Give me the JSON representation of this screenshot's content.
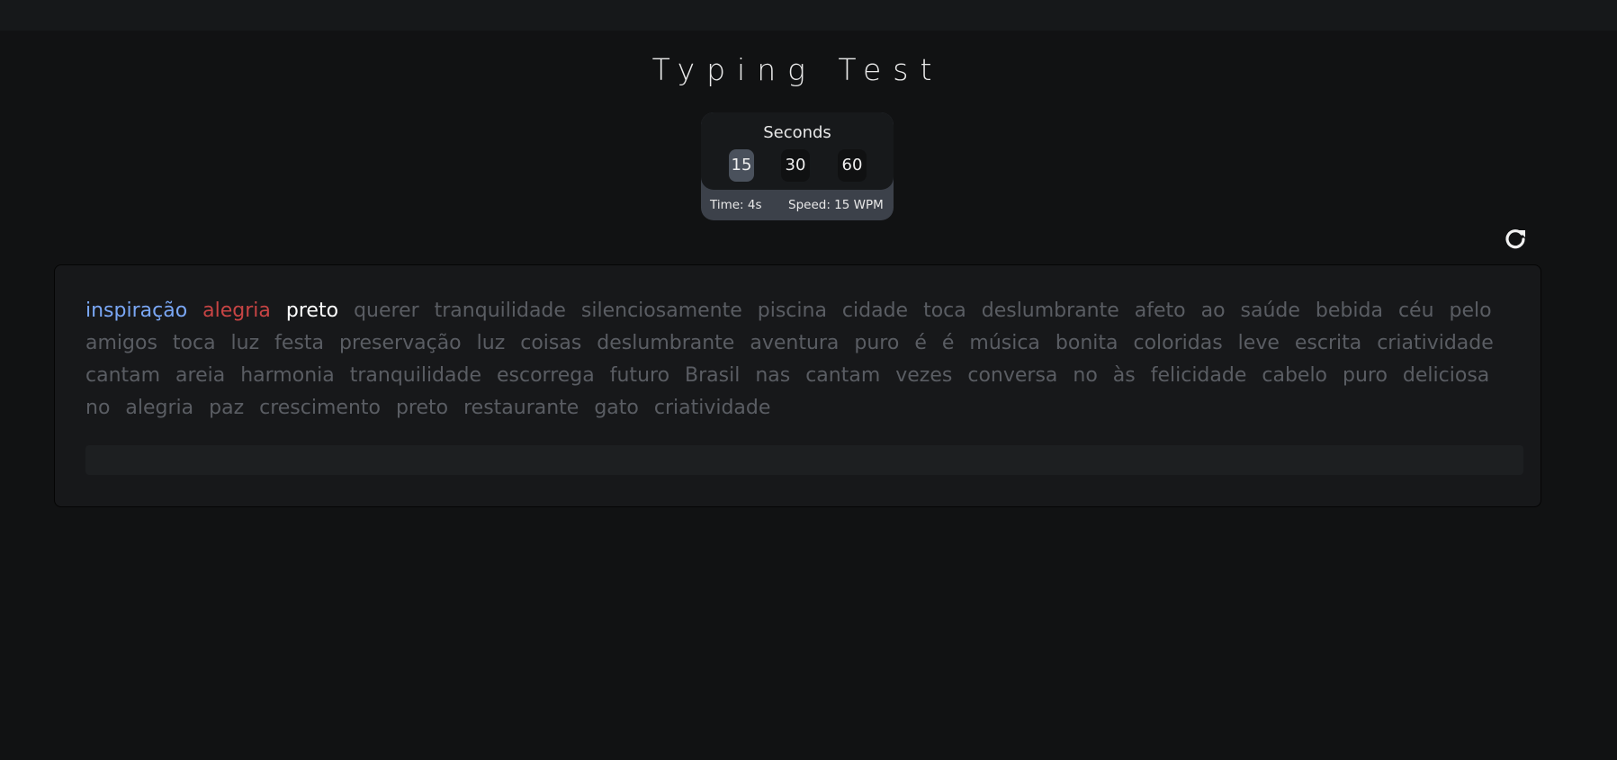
{
  "page": {
    "title": "Typing Test"
  },
  "settings": {
    "label": "Seconds",
    "options": [
      "15",
      "30",
      "60"
    ],
    "selected": "15",
    "time_text": "Time: 4s",
    "speed_text": "Speed: 15 WPM"
  },
  "colors": {
    "correct": "#7aa7f5",
    "incorrect": "#c74444",
    "current": "#ffffff",
    "pending": "#5a5d63"
  },
  "typing": {
    "typed_correct": "inspiração",
    "typed_incorrect": "alegria",
    "current_word": "preto",
    "remaining_text": "querer tranquilidade silenciosamente piscina cidade toca deslumbrante afeto ao saúde bebida céu pelo amigos toca luz festa preservação luz coisas deslumbrante aventura puro é é música bonita coloridas leve escrita criatividade cantam areia harmonia tranquilidade escorrega futuro Brasil nas cantam vezes conversa no às felicidade cabelo puro deliciosa no alegria paz crescimento preto restaurante gato criatividade",
    "input_value": ""
  },
  "icons": {
    "reset": "reload-icon"
  }
}
